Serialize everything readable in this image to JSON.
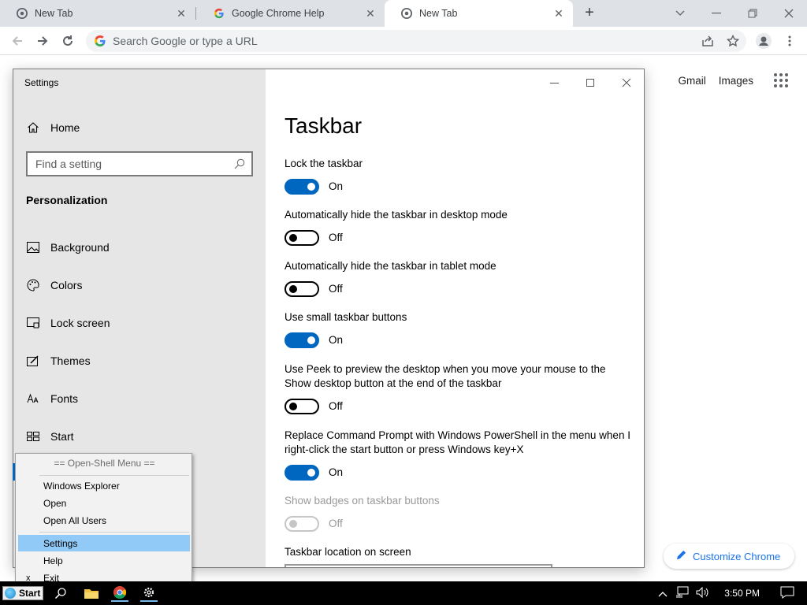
{
  "browser": {
    "tabs": [
      {
        "title": "New Tab",
        "active": false
      },
      {
        "title": "Google Chrome Help",
        "active": false
      },
      {
        "title": "New Tab",
        "active": true
      }
    ],
    "omnibox_placeholder": "Search Google or type a URL",
    "ntp": {
      "gmail": "Gmail",
      "images": "Images",
      "customize": "Customize Chrome"
    }
  },
  "settings": {
    "window_title": "Settings",
    "nav": {
      "home": "Home",
      "search_placeholder": "Find a setting",
      "section": "Personalization",
      "items": [
        {
          "label": "Background",
          "icon": "image-icon"
        },
        {
          "label": "Colors",
          "icon": "palette-icon"
        },
        {
          "label": "Lock screen",
          "icon": "lock-screen-icon"
        },
        {
          "label": "Themes",
          "icon": "themes-icon"
        },
        {
          "label": "Fonts",
          "icon": "fonts-icon"
        },
        {
          "label": "Start",
          "icon": "start-icon"
        }
      ]
    },
    "page_title": "Taskbar",
    "options": [
      {
        "label": "Lock the taskbar",
        "state": "On"
      },
      {
        "label": "Automatically hide the taskbar in desktop mode",
        "state": "Off"
      },
      {
        "label": "Automatically hide the taskbar in tablet mode",
        "state": "Off"
      },
      {
        "label": "Use small taskbar buttons",
        "state": "On"
      },
      {
        "label": "Use Peek to preview the desktop when you move your mouse to the Show desktop button at the end of the taskbar",
        "state": "Off"
      },
      {
        "label": "Replace Command Prompt with Windows PowerShell in the menu when I right-click the start button or press Windows key+X",
        "state": "On"
      },
      {
        "label": "Show badges on taskbar buttons",
        "state": "Off",
        "disabled": true
      }
    ],
    "location_label": "Taskbar location on screen"
  },
  "openshell_menu": {
    "header": "== Open-Shell Menu ==",
    "items": [
      "Windows Explorer",
      "Open",
      "Open All Users",
      "Settings",
      "Help",
      "Exit"
    ],
    "highlighted": "Settings",
    "exit_mark": "x"
  },
  "taskbar": {
    "start_label": "Start",
    "clock": "3:50 PM"
  },
  "colors": {
    "toggle_on": "#0067c0",
    "menu_highlight": "#91c9f7",
    "chrome_link": "#1a73e8"
  }
}
